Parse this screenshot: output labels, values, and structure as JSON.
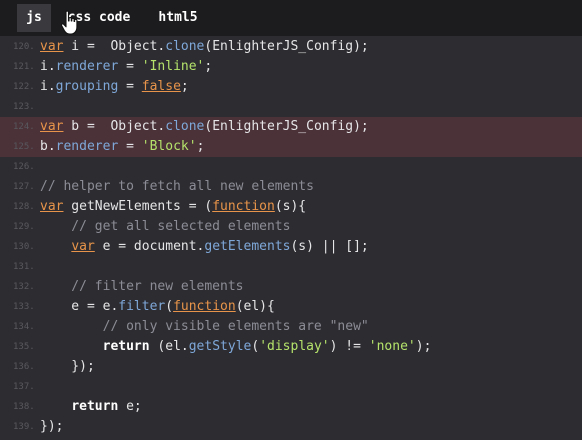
{
  "tabs": [
    {
      "label": "js"
    },
    {
      "label": "css code"
    },
    {
      "label": "html5"
    }
  ],
  "lines": [
    {
      "n": "120.",
      "hl": false,
      "t": [
        [
          "kw",
          "var"
        ],
        [
          "id",
          " i =  Object."
        ],
        [
          "prop",
          "clone"
        ],
        [
          "id",
          "(EnlighterJS_Config);"
        ]
      ]
    },
    {
      "n": "121.",
      "hl": false,
      "t": [
        [
          "id",
          "i."
        ],
        [
          "prop",
          "renderer"
        ],
        [
          "id",
          " = "
        ],
        [
          "str",
          "'Inline'"
        ],
        [
          "id",
          ";"
        ]
      ]
    },
    {
      "n": "122.",
      "hl": false,
      "t": [
        [
          "id",
          "i."
        ],
        [
          "prop",
          "grouping"
        ],
        [
          "id",
          " = "
        ],
        [
          "bool",
          "false"
        ],
        [
          "id",
          ";"
        ]
      ]
    },
    {
      "n": "123.",
      "hl": false,
      "t": []
    },
    {
      "n": "124.",
      "hl": true,
      "t": [
        [
          "kw",
          "var"
        ],
        [
          "id",
          " b =  Object."
        ],
        [
          "prop",
          "clone"
        ],
        [
          "id",
          "(EnlighterJS_Config);"
        ]
      ]
    },
    {
      "n": "125.",
      "hl": true,
      "t": [
        [
          "id",
          "b."
        ],
        [
          "prop",
          "renderer"
        ],
        [
          "id",
          " = "
        ],
        [
          "str",
          "'Block'"
        ],
        [
          "id",
          ";"
        ]
      ]
    },
    {
      "n": "126.",
      "hl": false,
      "t": []
    },
    {
      "n": "127.",
      "hl": false,
      "t": [
        [
          "cmt",
          "// helper to fetch all new elements"
        ]
      ]
    },
    {
      "n": "128.",
      "hl": false,
      "t": [
        [
          "kw",
          "var"
        ],
        [
          "id",
          " getNewElements = ("
        ],
        [
          "fnu",
          "function"
        ],
        [
          "id",
          "(s){"
        ]
      ]
    },
    {
      "n": "129.",
      "hl": false,
      "t": [
        [
          "cmt",
          "    // get all selected elements"
        ]
      ]
    },
    {
      "n": "130.",
      "hl": false,
      "t": [
        [
          "id",
          "    "
        ],
        [
          "kw",
          "var"
        ],
        [
          "id",
          " e = document."
        ],
        [
          "prop",
          "getElements"
        ],
        [
          "id",
          "(s) || [];"
        ]
      ]
    },
    {
      "n": "131.",
      "hl": false,
      "t": []
    },
    {
      "n": "132.",
      "hl": false,
      "t": [
        [
          "cmt",
          "    // filter new elements"
        ]
      ]
    },
    {
      "n": "133.",
      "hl": false,
      "t": [
        [
          "id",
          "    e = e."
        ],
        [
          "prop",
          "filter"
        ],
        [
          "id",
          "("
        ],
        [
          "fnu",
          "function"
        ],
        [
          "id",
          "(el){"
        ]
      ]
    },
    {
      "n": "134.",
      "hl": false,
      "t": [
        [
          "cmt",
          "        // only visible elements are \"new\""
        ]
      ]
    },
    {
      "n": "135.",
      "hl": false,
      "t": [
        [
          "id",
          "        "
        ],
        [
          "kwb",
          "return"
        ],
        [
          "id",
          " (el."
        ],
        [
          "prop",
          "getStyle"
        ],
        [
          "id",
          "("
        ],
        [
          "str",
          "'display'"
        ],
        [
          "id",
          ") != "
        ],
        [
          "str",
          "'none'"
        ],
        [
          "id",
          ");"
        ]
      ]
    },
    {
      "n": "136.",
      "hl": false,
      "t": [
        [
          "id",
          "    });"
        ]
      ]
    },
    {
      "n": "137.",
      "hl": false,
      "t": []
    },
    {
      "n": "138.",
      "hl": false,
      "t": [
        [
          "id",
          "    "
        ],
        [
          "kwb",
          "return"
        ],
        [
          "id",
          " e;"
        ]
      ]
    },
    {
      "n": "139.",
      "hl": false,
      "t": [
        [
          "id",
          "});"
        ]
      ]
    }
  ],
  "colors": {
    "background": "#2d2d31",
    "tabbar": "#1c1c1f",
    "highlight": "#4a3238",
    "keyword": "#e8944a",
    "property": "#7fa8d9",
    "string": "#b5e36b",
    "comment": "#8c8c96"
  },
  "icons": {
    "cursor": "hand-pointer-icon"
  }
}
